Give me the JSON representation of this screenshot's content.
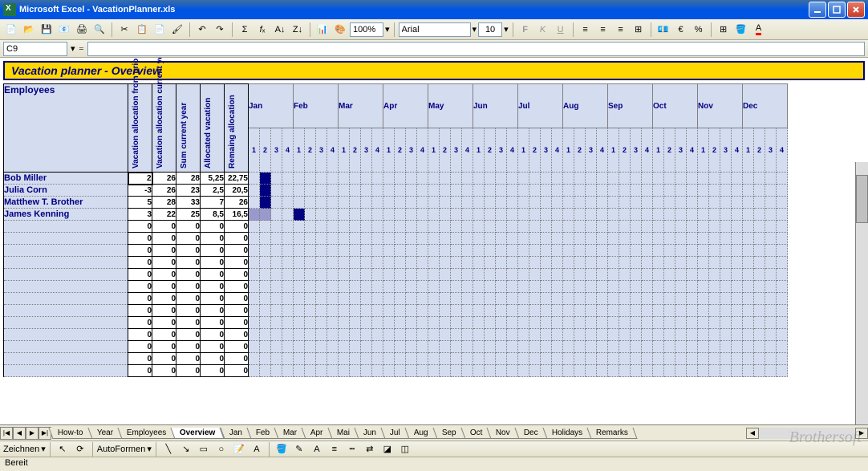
{
  "app": {
    "title": "Microsoft Excel - VacationPlanner.xls"
  },
  "toolbar": {
    "zoom": "100%",
    "font": "Arial",
    "font_size": "10"
  },
  "formula_bar": {
    "cell_ref": "C9",
    "formula": ""
  },
  "sheet": {
    "title": "Vacation planner - Overview",
    "employees_header": "Employees",
    "col_headers": [
      "Vacation allocation from prior year",
      "Vacation allocation current year",
      "Sum current year",
      "Allocated vacation",
      "Remaing allocation"
    ],
    "months": [
      "Jan",
      "Feb",
      "Mar",
      "Apr",
      "May",
      "Jun",
      "Jul",
      "Aug",
      "Sep",
      "Oct",
      "Nov",
      "Dec"
    ],
    "weeks": [
      "1",
      "2",
      "3",
      "4"
    ],
    "rows": [
      {
        "name": "Bob Miller",
        "vals": [
          "2",
          "26",
          "28",
          "5,25",
          "22,75"
        ],
        "hl": [
          {
            "m": 0,
            "w": 1,
            "c": "dark"
          }
        ]
      },
      {
        "name": "Julia Corn",
        "vals": [
          "-3",
          "26",
          "23",
          "2,5",
          "20,5"
        ],
        "hl": [
          {
            "m": 0,
            "w": 1,
            "c": "dark"
          }
        ]
      },
      {
        "name": "Matthew T. Brother",
        "vals": [
          "5",
          "28",
          "33",
          "7",
          "26"
        ],
        "hl": [
          {
            "m": 0,
            "w": 1,
            "c": "dark"
          }
        ]
      },
      {
        "name": "James Kenning",
        "vals": [
          "3",
          "22",
          "25",
          "8,5",
          "16,5"
        ],
        "hl": [
          {
            "m": 0,
            "w": 0,
            "c": "light"
          },
          {
            "m": 0,
            "w": 1,
            "c": "light"
          },
          {
            "m": 1,
            "w": 0,
            "c": "dark"
          }
        ]
      },
      {
        "name": "",
        "vals": [
          "0",
          "0",
          "0",
          "0",
          "0"
        ],
        "hl": []
      },
      {
        "name": "",
        "vals": [
          "0",
          "0",
          "0",
          "0",
          "0"
        ],
        "hl": []
      },
      {
        "name": "",
        "vals": [
          "0",
          "0",
          "0",
          "0",
          "0"
        ],
        "hl": []
      },
      {
        "name": "",
        "vals": [
          "0",
          "0",
          "0",
          "0",
          "0"
        ],
        "hl": []
      },
      {
        "name": "",
        "vals": [
          "0",
          "0",
          "0",
          "0",
          "0"
        ],
        "hl": []
      },
      {
        "name": "",
        "vals": [
          "0",
          "0",
          "0",
          "0",
          "0"
        ],
        "hl": []
      },
      {
        "name": "",
        "vals": [
          "0",
          "0",
          "0",
          "0",
          "0"
        ],
        "hl": []
      },
      {
        "name": "",
        "vals": [
          "0",
          "0",
          "0",
          "0",
          "0"
        ],
        "hl": []
      },
      {
        "name": "",
        "vals": [
          "0",
          "0",
          "0",
          "0",
          "0"
        ],
        "hl": []
      },
      {
        "name": "",
        "vals": [
          "0",
          "0",
          "0",
          "0",
          "0"
        ],
        "hl": []
      },
      {
        "name": "",
        "vals": [
          "0",
          "0",
          "0",
          "0",
          "0"
        ],
        "hl": []
      },
      {
        "name": "",
        "vals": [
          "0",
          "0",
          "0",
          "0",
          "0"
        ],
        "hl": []
      },
      {
        "name": "",
        "vals": [
          "0",
          "0",
          "0",
          "0",
          "0"
        ],
        "hl": []
      }
    ]
  },
  "tabs": [
    "How-to",
    "Year",
    "Employees",
    "Overview",
    "Jan",
    "Feb",
    "Mar",
    "Apr",
    "Mai",
    "Jun",
    "Jul",
    "Aug",
    "Sep",
    "Oct",
    "Nov",
    "Dec",
    "Holidays",
    "Remarks"
  ],
  "active_tab": 3,
  "bottom_toolbar": {
    "draw_label": "Zeichnen",
    "autoshapes": "AutoFormen"
  },
  "status": "Bereit",
  "watermark": "Brothersoft"
}
